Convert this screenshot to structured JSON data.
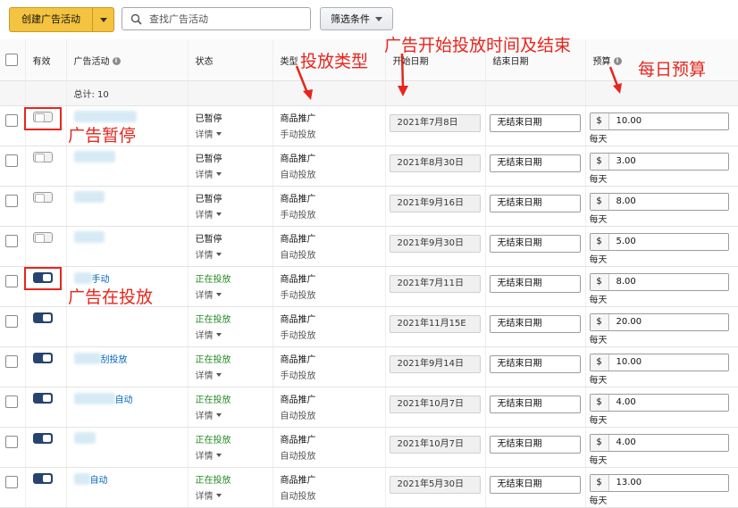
{
  "toolbar": {
    "create_label": "创建广告活动",
    "search_placeholder": "查找广告活动",
    "filter_label": "筛选条件"
  },
  "columns": {
    "active": "有效",
    "campaign": "广告活动",
    "status": "状态",
    "type": "类型",
    "start": "开始日期",
    "end": "结束日期",
    "budget": "预算"
  },
  "total_label": "总计: 10",
  "status_detail_label": "详情",
  "per_day_label": "每天",
  "currency_symbol": "$",
  "rows": [
    {
      "active": false,
      "name": "",
      "status": "已暂停",
      "type": "商品推广",
      "targeting": "手动投放",
      "start": "2021年7月8日",
      "end": "无结束日期",
      "budget": "10.00"
    },
    {
      "active": false,
      "name": "",
      "status": "已暂停",
      "type": "商品推广",
      "targeting": "自动投放",
      "start": "2021年8月30日",
      "end": "无结束日期",
      "budget": "3.00"
    },
    {
      "active": false,
      "name": "",
      "status": "已暂停",
      "type": "商品推广",
      "targeting": "手动投放",
      "start": "2021年9月16日",
      "end": "无结束日期",
      "budget": "8.00"
    },
    {
      "active": false,
      "name": "",
      "status": "已暂停",
      "type": "商品推广",
      "targeting": "自动投放",
      "start": "2021年9月30日",
      "end": "无结束日期",
      "budget": "5.00"
    },
    {
      "active": true,
      "name": "手动",
      "status": "正在投放",
      "type": "商品推广",
      "targeting": "手动投放",
      "start": "2021年7月11日",
      "end": "无结束日期",
      "budget": "8.00"
    },
    {
      "active": true,
      "name": "",
      "status": "正在投放",
      "type": "商品推广",
      "targeting": "手动投放",
      "start": "2021年11月15E",
      "end": "无结束日期",
      "budget": "20.00"
    },
    {
      "active": true,
      "name": "刮投放",
      "status": "正在投放",
      "type": "商品推广",
      "targeting": "手动投放",
      "start": "2021年9月14日",
      "end": "无结束日期",
      "budget": "10.00"
    },
    {
      "active": true,
      "name": "自动",
      "status": "正在投放",
      "type": "商品推广",
      "targeting": "自动投放",
      "start": "2021年10月7日",
      "end": "无结束日期",
      "budget": "4.00"
    },
    {
      "active": true,
      "name": "",
      "status": "正在投放",
      "type": "商品推广",
      "targeting": "自动投放",
      "start": "2021年10月7日",
      "end": "无结束日期",
      "budget": "4.00"
    },
    {
      "active": true,
      "name": "自动",
      "status": "正在投放",
      "type": "商品推广",
      "targeting": "自动投放",
      "start": "2021年5月30日",
      "end": "无结束日期",
      "budget": "13.00"
    }
  ],
  "annotations": {
    "paused": "广告暂停",
    "running": "广告在投放",
    "type": "投放类型",
    "start_end": "广告开始投放时间及结束",
    "daily_budget": "每日预算"
  },
  "colors": {
    "annotation": "#e8251c",
    "toggle_on": "#27436f",
    "running_status": "#238a23",
    "create_button": "#f4c33f"
  }
}
